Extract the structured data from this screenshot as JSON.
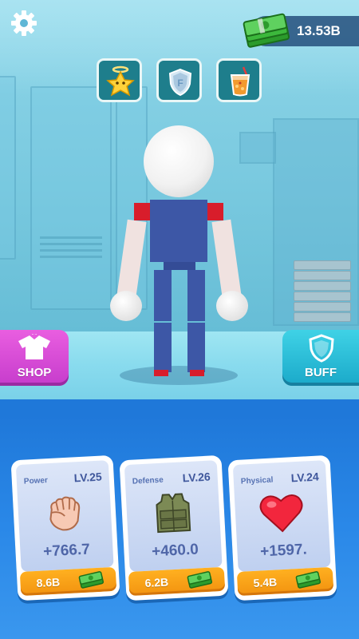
{
  "hud": {
    "money": "13.53B",
    "settings_icon": "gear-icon",
    "money_icon": "cash-stack-icon"
  },
  "boosts": [
    {
      "icon": "angel-star-icon"
    },
    {
      "icon": "shield-icon"
    },
    {
      "icon": "drink-icon"
    }
  ],
  "side_buttons": {
    "shop_label": "SHOP",
    "buff_label": "BUFF"
  },
  "cards": [
    {
      "title": "Power",
      "level": "LV.25",
      "value": "+766.7",
      "cost": "8.6B",
      "icon": "fist-icon"
    },
    {
      "title": "Defense",
      "level": "LV.26",
      "value": "+460.0",
      "cost": "6.2B",
      "icon": "armor-vest-icon"
    },
    {
      "title": "Physical",
      "level": "LV.24",
      "value": "+1597.",
      "cost": "5.4B",
      "icon": "heart-icon"
    }
  ],
  "colors": {
    "shop": "#d94bd6",
    "buff": "#22b5d4",
    "cost": "#f6a218",
    "panel": "#2a88e8"
  }
}
